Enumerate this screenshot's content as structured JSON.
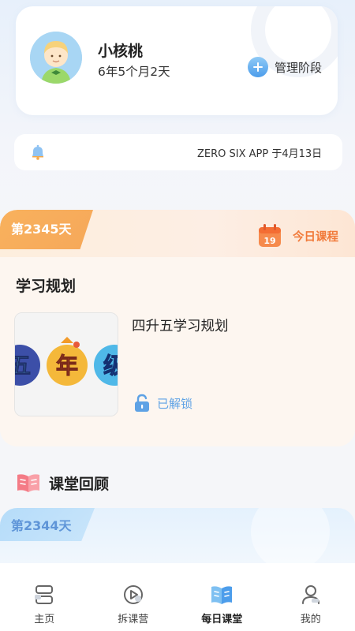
{
  "profile": {
    "name": "小核桃",
    "age": "6年5个月2天",
    "manage_label": "管理阶段"
  },
  "notice": {
    "text": "ZERO SIX APP 于4月13日"
  },
  "today": {
    "day_tag": "第2345天",
    "calendar_day": "19",
    "label": "今日课程",
    "plan_section_title": "学习规划",
    "plan_name": "四升五学习规划",
    "thumb_chars": [
      "五",
      "年",
      "级"
    ],
    "unlock_status": "已解锁"
  },
  "review": {
    "title": "课堂回顾",
    "day_tag": "第2344天"
  },
  "nav": {
    "items": [
      {
        "label": "主页",
        "icon": "home-icon"
      },
      {
        "label": "拆课营",
        "icon": "camp-icon"
      },
      {
        "label": "每日课堂",
        "icon": "book-icon",
        "active": true
      },
      {
        "label": "我的",
        "icon": "profile-icon"
      }
    ]
  },
  "colors": {
    "accent_orange": "#f17a3a",
    "accent_blue": "#4c9deb",
    "unlock_blue": "#5ea2e5"
  }
}
